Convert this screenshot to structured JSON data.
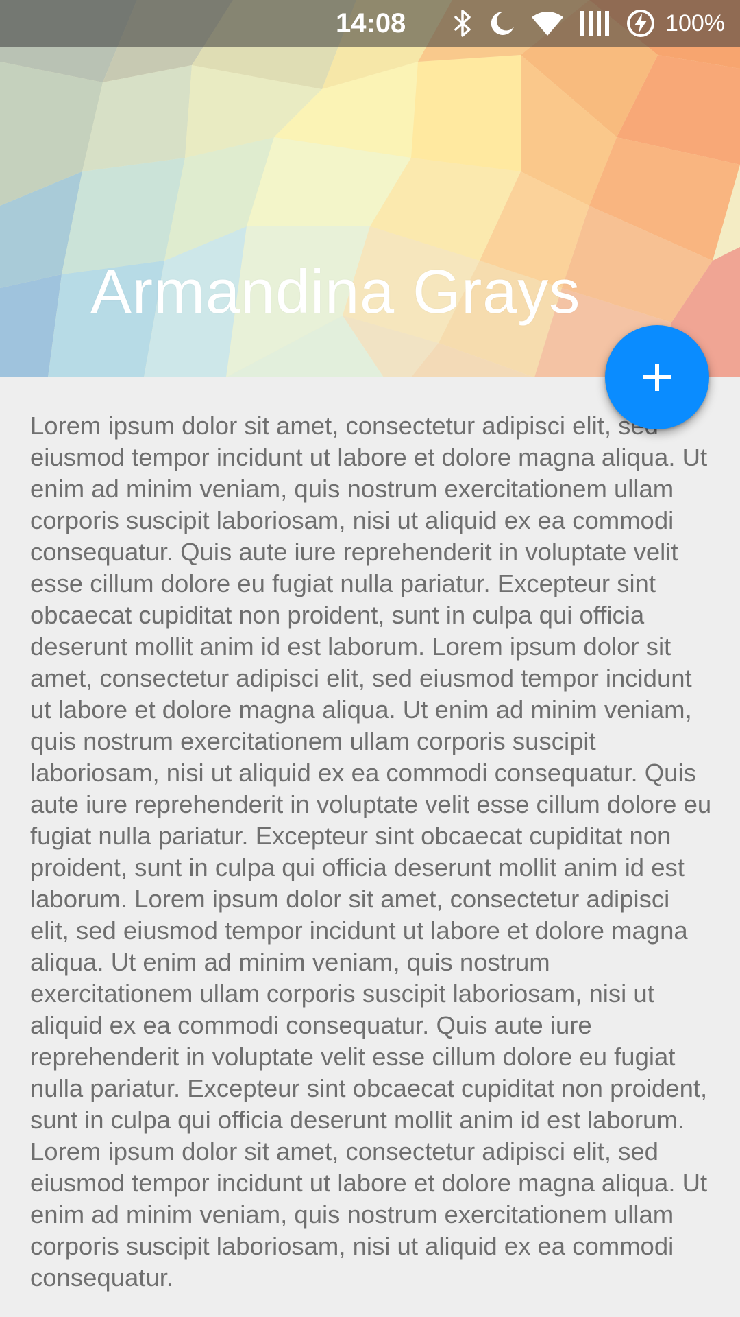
{
  "status_bar": {
    "time": "14:08",
    "battery_percent": "100%",
    "icons": [
      "bluetooth-icon",
      "do-not-disturb-moon-icon",
      "wifi-icon",
      "signal-icon",
      "battery-charging-icon"
    ]
  },
  "header": {
    "title": "Armandina Grays"
  },
  "fab": {
    "icon": "plus-icon",
    "color": "#0A8CFF"
  },
  "content": {
    "body": "Lorem ipsum dolor sit amet, consectetur adipisci elit, sed eiusmod tempor incidunt ut labore et dolore magna aliqua. Ut enim ad minim veniam, quis nostrum exercitationem ullam corporis suscipit laboriosam, nisi ut aliquid ex ea commodi consequatur. Quis aute iure reprehenderit in voluptate velit esse cillum dolore eu fugiat nulla pariatur. Excepteur sint obcaecat cupiditat non proident, sunt in culpa qui officia deserunt mollit anim id est laborum. Lorem ipsum dolor sit amet, consectetur adipisci elit, sed eiusmod tempor incidunt ut labore et dolore magna aliqua. Ut enim ad minim veniam, quis nostrum exercitationem ullam corporis suscipit laboriosam, nisi ut aliquid ex ea commodi consequatur. Quis aute iure reprehenderit in voluptate velit esse cillum dolore eu fugiat nulla pariatur. Excepteur sint obcaecat cupiditat non proident, sunt in culpa qui officia deserunt mollit anim id est laborum. Lorem ipsum dolor sit amet, consectetur adipisci elit, sed eiusmod tempor incidunt ut labore et dolore magna aliqua. Ut enim ad minim veniam, quis nostrum exercitationem ullam corporis suscipit laboriosam, nisi ut aliquid ex ea commodi consequatur. Quis aute iure reprehenderit in voluptate velit esse cillum dolore eu fugiat nulla pariatur. Excepteur sint obcaecat cupiditat non proident, sunt in culpa qui officia deserunt mollit anim id est laborum. Lorem ipsum dolor sit amet, consectetur adipisci elit, sed eiusmod tempor incidunt ut labore et dolore magna aliqua. Ut enim ad minim veniam, quis nostrum exercitationem ullam corporis suscipit laboriosam, nisi ut aliquid ex ea commodi consequatur."
  }
}
